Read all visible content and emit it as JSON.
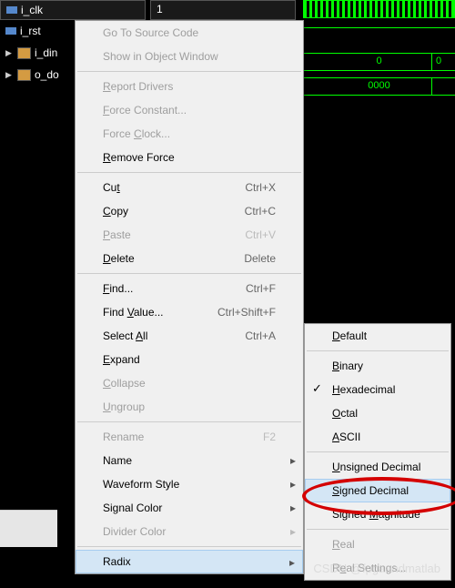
{
  "signals": {
    "clk": "i_clk",
    "rst": "i_rst",
    "din": "i_din",
    "dout": "o_do"
  },
  "values": {
    "clk": "1",
    "din": "0",
    "din_alt": "0",
    "dout": "0000"
  },
  "main_menu": [
    {
      "label": "Go To Source Code",
      "disabled": true
    },
    {
      "label": "Show in Object Window",
      "disabled": true
    },
    {
      "sep": true
    },
    {
      "label": "Report Drivers",
      "disabled": true,
      "u": 0
    },
    {
      "label": "Force Constant...",
      "disabled": true,
      "u": 0
    },
    {
      "label": "Force Clock...",
      "disabled": true,
      "u": 6
    },
    {
      "label": "Remove Force",
      "u": 0
    },
    {
      "sep": true
    },
    {
      "label": "Cut",
      "shortcut": "Ctrl+X",
      "u": 2
    },
    {
      "label": "Copy",
      "shortcut": "Ctrl+C",
      "u": 0
    },
    {
      "label": "Paste",
      "shortcut": "Ctrl+V",
      "disabled": true,
      "u": 0
    },
    {
      "label": "Delete",
      "shortcut": "Delete",
      "u": 0
    },
    {
      "sep": true
    },
    {
      "label": "Find...",
      "shortcut": "Ctrl+F",
      "u": 0
    },
    {
      "label": "Find Value...",
      "shortcut": "Ctrl+Shift+F",
      "ucustom": "Find <u>V</u>alue..."
    },
    {
      "label": "Select All",
      "shortcut": "Ctrl+A",
      "ucustom": "Select <u>A</u>ll"
    },
    {
      "label": "Expand",
      "u": 0
    },
    {
      "label": "Collapse",
      "disabled": true,
      "u": 0
    },
    {
      "label": "Ungroup",
      "disabled": true,
      "u": 0
    },
    {
      "sep": true
    },
    {
      "label": "Rename",
      "shortcut": "F2",
      "disabled": true
    },
    {
      "label": "Name",
      "submenu": true
    },
    {
      "label": "Waveform Style",
      "submenu": true
    },
    {
      "label": "Signal Color",
      "submenu": true
    },
    {
      "label": "Divider Color",
      "submenu": true,
      "disabled": true
    },
    {
      "sep": true
    },
    {
      "label": "Radix",
      "submenu": true,
      "hover": true
    }
  ],
  "sub_menu": [
    {
      "label": "Default",
      "u": 0
    },
    {
      "sep": true
    },
    {
      "label": "Binary",
      "u": 0
    },
    {
      "label": "Hexadecimal",
      "checked": true,
      "u": 0
    },
    {
      "label": "Octal",
      "u": 0
    },
    {
      "label": "ASCII",
      "u": 0
    },
    {
      "sep": true
    },
    {
      "label": "Unsigned Decimal",
      "u": 0
    },
    {
      "label": "Signed Decimal",
      "hover": true,
      "u": 0
    },
    {
      "label": "Signed Magnitude",
      "ucustom": "Signed <u>M</u>agnitude"
    },
    {
      "sep": true
    },
    {
      "label": "Real",
      "disabled": true,
      "u": 0
    },
    {
      "label": "Real Settings...",
      "disabled": true,
      "ucustom": "R<u>e</u>al Settings..."
    }
  ],
  "watermark": "CSDN @fpgaandmatlab"
}
